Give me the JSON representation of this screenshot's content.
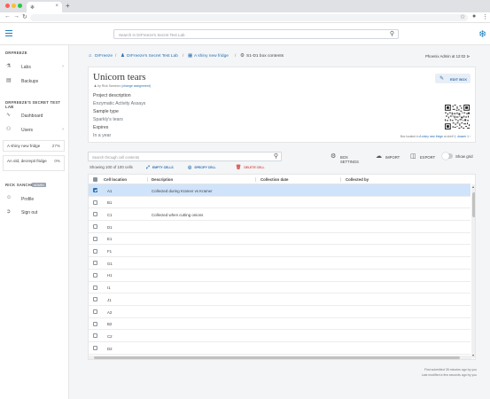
{
  "browser": {
    "tab_title": "",
    "colors": {
      "close": "#ff5f57",
      "minimize": "#febc2e",
      "maximize": "#28c840"
    }
  },
  "header": {
    "search_placeholder": "Search in DrFreeze's Secret Test Lab"
  },
  "sidebar": {
    "section_user": "DRFREEZE",
    "labs_label": "Labs",
    "backups_label": "Backups",
    "section_lab": "DRFREEZE'S SECRET TEST LAB",
    "dashboard_label": "Dashboard",
    "users_label": "Users",
    "fridges": [
      {
        "name": "A shiny new fridge",
        "percent": "27%"
      },
      {
        "name": "An old, decrepit fridge",
        "percent": "0%"
      }
    ],
    "section_account": "RICK SANCHEZ",
    "admin_badge": "ADMIN",
    "profile_label": "Profile",
    "signout_label": "Sign out"
  },
  "breadcrumb": {
    "items": [
      "DrFreeze",
      "DrFreeze's Secret Test Lab",
      "A shiny new fridge",
      "S1-D1 box contents"
    ],
    "sep": "/",
    "phoenix": "Phoenix Admin at 12:02"
  },
  "box": {
    "title": "Unicorn tears",
    "byline_prefix": "by Rick Sanchez",
    "byline_link": "(change assignment)",
    "project_label": "Project description",
    "project_value": "Enzymatic Activity Assays",
    "sample_label": "Sample type",
    "sample_value": "Sparkly's tears",
    "expires_label": "Expires",
    "expires_value": "In a year",
    "edit_label": "EDIT BOX",
    "located_prefix": "Box located in",
    "located_link": "A shiny new fridge",
    "located_mid": "at shelf",
    "located_shelf": "1, drawer 1"
  },
  "toolbar": {
    "cell_search_placeholder": "Search through cell contents",
    "box_settings": "BOX SETTINGS",
    "import": "IMPORT",
    "export": "EXPORT",
    "show_grid": "Show grid",
    "showing": "Showing 100 of 100 cells",
    "empty_cells": "EMPTY CELLS",
    "specify_cell": "SPECIFY CELL",
    "delete_cell": "DELETE CELL",
    "action_colors": {
      "empty": "#2a6fb3",
      "specify": "#2a6fb3",
      "delete": "#d9534f"
    }
  },
  "table": {
    "columns": [
      "Cell location",
      "Description",
      "Collection date",
      "Collected by"
    ],
    "rows": [
      {
        "loc": "A1",
        "desc": "Collected during Kramer vs Kramer",
        "selected": true
      },
      {
        "loc": "B1",
        "desc": "",
        "selected": false
      },
      {
        "loc": "C1",
        "desc": "Collected when cutting onions",
        "selected": false
      },
      {
        "loc": "D1",
        "desc": "",
        "selected": false
      },
      {
        "loc": "E1",
        "desc": "",
        "selected": false
      },
      {
        "loc": "F1",
        "desc": "",
        "selected": false
      },
      {
        "loc": "G1",
        "desc": "",
        "selected": false
      },
      {
        "loc": "H1",
        "desc": "",
        "selected": false
      },
      {
        "loc": "I1",
        "desc": "",
        "selected": false
      },
      {
        "loc": "J1",
        "desc": "",
        "selected": false
      },
      {
        "loc": "A2",
        "desc": "",
        "selected": false
      },
      {
        "loc": "B2",
        "desc": "",
        "selected": false
      },
      {
        "loc": "C2",
        "desc": "",
        "selected": false
      },
      {
        "loc": "D2",
        "desc": "",
        "selected": false
      }
    ]
  },
  "footer": {
    "line1": "First submitted 35 minutes ago by you",
    "line2": "Last modified a few seconds ago by you"
  }
}
